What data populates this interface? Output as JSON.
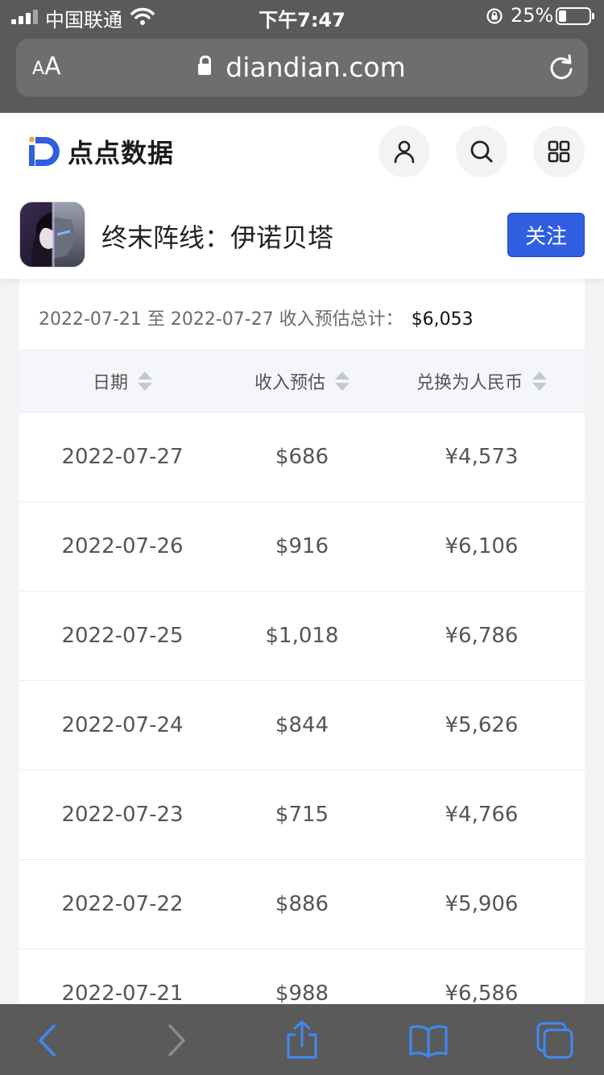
{
  "status_bar": {
    "carrier": "中国联通",
    "time": "下午7:47",
    "battery_percent": "25%",
    "battery_level": 0.25
  },
  "browser": {
    "text_size_button": {
      "small": "A",
      "large": "A"
    },
    "url": "diandian.com"
  },
  "site": {
    "logo_text": "点点数据",
    "brand_color": "#2f5fe0"
  },
  "app": {
    "name": "终末阵线：伊诺贝塔",
    "follow_label": "关注"
  },
  "summary": {
    "range_text": "2022-07-21 至 2022-07-27 收入预估总计：",
    "total": "$6,053"
  },
  "table": {
    "headers": [
      "日期",
      "收入预估",
      "兑换为人民币"
    ],
    "rows": [
      {
        "date": "2022-07-27",
        "revenue": "$686",
        "rmb": "¥4,573"
      },
      {
        "date": "2022-07-26",
        "revenue": "$916",
        "rmb": "¥6,106"
      },
      {
        "date": "2022-07-25",
        "revenue": "$1,018",
        "rmb": "¥6,786"
      },
      {
        "date": "2022-07-24",
        "revenue": "$844",
        "rmb": "¥5,626"
      },
      {
        "date": "2022-07-23",
        "revenue": "$715",
        "rmb": "¥4,766"
      },
      {
        "date": "2022-07-22",
        "revenue": "$886",
        "rmb": "¥5,906"
      },
      {
        "date": "2022-07-21",
        "revenue": "$988",
        "rmb": "¥6,586"
      }
    ]
  },
  "toolbar_icons": [
    "back-icon",
    "forward-icon",
    "share-icon",
    "bookmarks-icon",
    "tabs-icon"
  ]
}
